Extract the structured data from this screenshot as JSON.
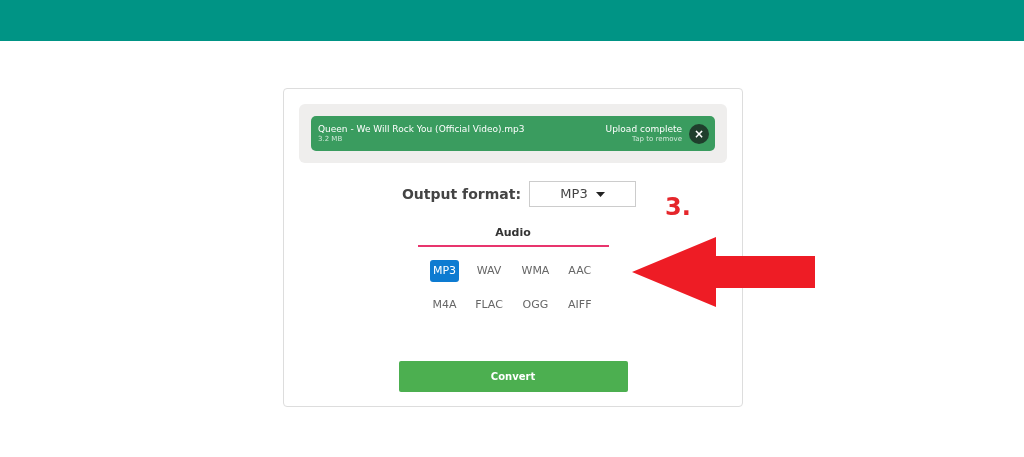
{
  "upload": {
    "file_name": "Queen - We Will Rock You (Official Video).mp3",
    "size": "3.2 MB",
    "status": "Upload complete",
    "hint": "Tap to remove",
    "remove_label": "×"
  },
  "output_format": {
    "label": "Output format:",
    "value": "MP3"
  },
  "group": {
    "title": "Audio",
    "formats": [
      {
        "label": "MP3",
        "selected": true
      },
      {
        "label": "WAV",
        "selected": false
      },
      {
        "label": "WMA",
        "selected": false
      },
      {
        "label": "AAC",
        "selected": false
      },
      {
        "label": "M4A",
        "selected": false
      },
      {
        "label": "FLAC",
        "selected": false
      },
      {
        "label": "OGG",
        "selected": false
      },
      {
        "label": "AIFF",
        "selected": false
      }
    ]
  },
  "convert_button": "Convert",
  "annotation": {
    "step": "3."
  }
}
